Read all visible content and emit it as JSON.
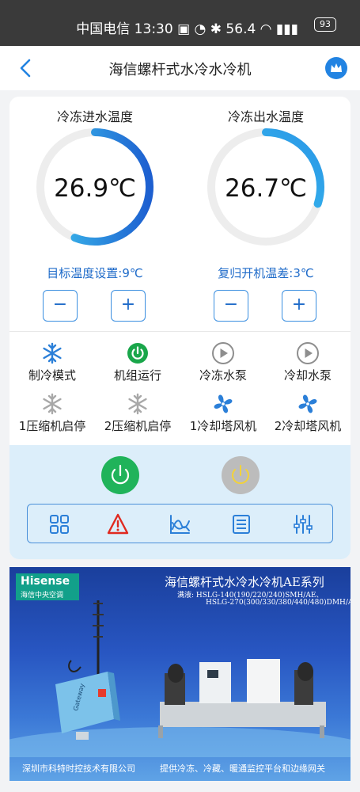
{
  "status_bar": {
    "text": "中国电信 13:30  ▣ ◔ ✱ 56.4 ◠ ▮▮▮",
    "battery": "93"
  },
  "header": {
    "title": "海信螺杆式水冷水冷机"
  },
  "gauges": [
    {
      "label": "冷冻进水温度",
      "value": "26.9℃",
      "setting": "目标温度设置:9℃",
      "level": 0.56
    },
    {
      "label": "冷冻出水温度",
      "value": "26.7℃",
      "setting": "复归开机温差:3℃",
      "level": 0.3
    }
  ],
  "stepper": {
    "minus": "−",
    "plus": "+"
  },
  "status_items": [
    {
      "label": "制冷模式",
      "icon": "snowflake-icon",
      "color": "#2b7fd8"
    },
    {
      "label": "机组运行",
      "icon": "power-icon",
      "color": "#19a64a"
    },
    {
      "label": "冷冻水泵",
      "icon": "play-icon",
      "color": "#8e8e8e"
    },
    {
      "label": "冷却水泵",
      "icon": "play-icon",
      "color": "#8e8e8e"
    },
    {
      "label": "1压缩机启停",
      "icon": "snowflake-icon",
      "color": "#a8a8a8"
    },
    {
      "label": "2压缩机启停",
      "icon": "snowflake-icon",
      "color": "#a8a8a8"
    },
    {
      "label": "1冷却塔风机",
      "icon": "fan-icon",
      "color": "#2b7fd8"
    },
    {
      "label": "2冷却塔风机",
      "icon": "fan-icon",
      "color": "#2b7fd8"
    }
  ],
  "controls": {
    "power_on_color": "#20b35a",
    "power_off_color": "#b9b9b9"
  },
  "toolbar": [
    "grid-icon",
    "warning-icon",
    "chart-icon",
    "list-icon",
    "settings-sliders-icon"
  ],
  "banner": {
    "brand": "Hisense",
    "brand_sub": "海信中央空调",
    "title": "海信螺杆式水冷水冷机AE系列",
    "sub_line1": "满液:  HSLG-140(190/220/240)SMH/AE、",
    "sub_line2": "HSLG-270(300/330/380/440/480)DMH/AE",
    "device_label": "Gateway",
    "footer_left": "深圳市科特时控技术有限公司",
    "footer_right": "提供冷冻、冷藏、暖通监控平台和边缘网关"
  }
}
